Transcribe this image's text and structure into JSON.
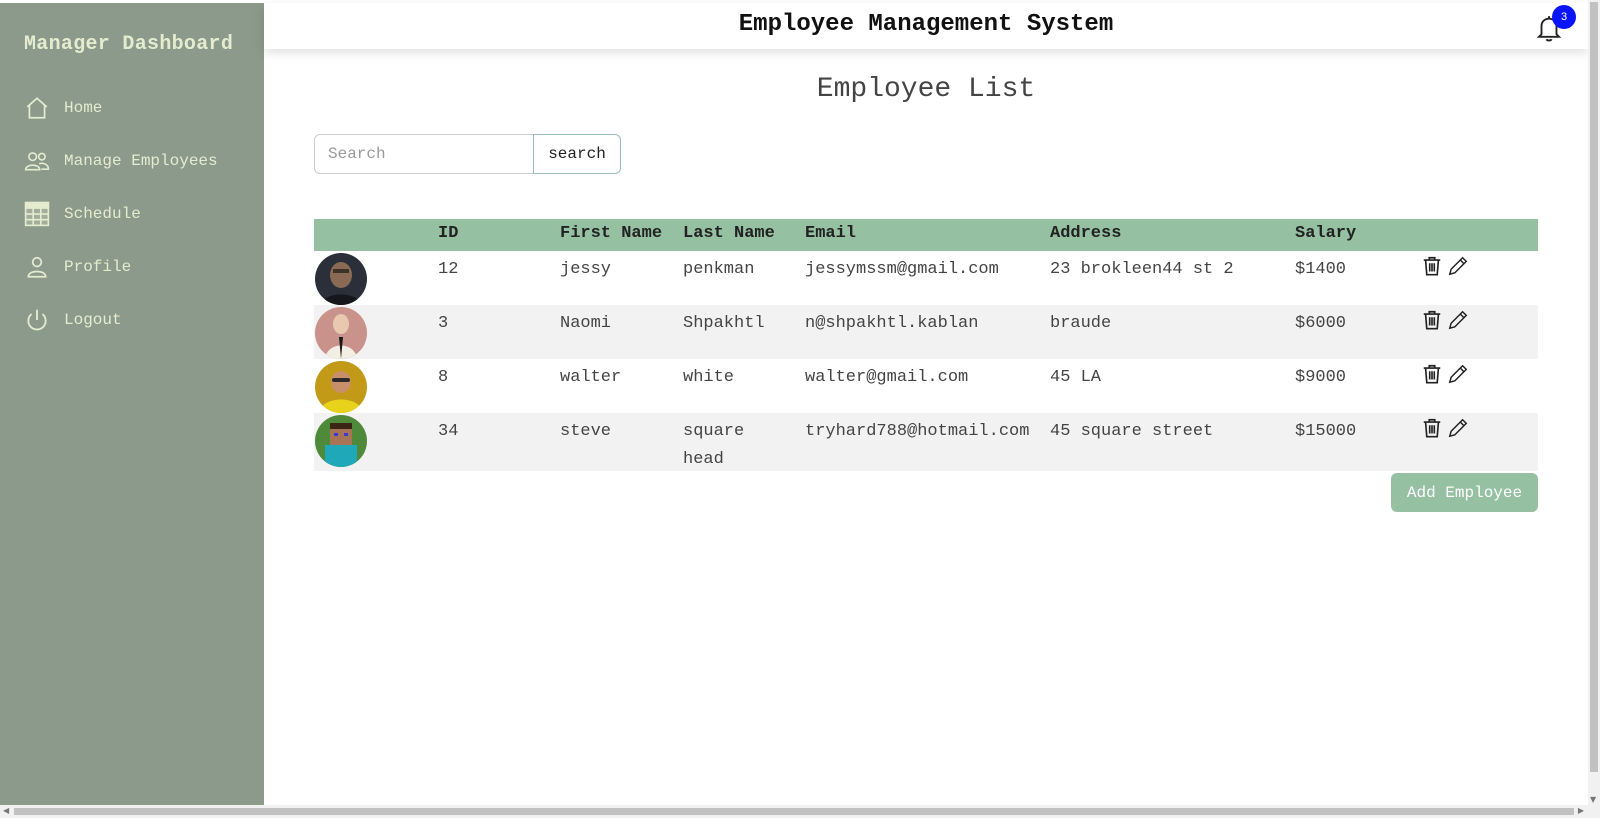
{
  "sidebar": {
    "title": "Manager Dashboard",
    "items": [
      {
        "label": "Home",
        "icon": "home-icon"
      },
      {
        "label": "Manage Employees",
        "icon": "users-icon"
      },
      {
        "label": "Schedule",
        "icon": "table-grid-icon"
      },
      {
        "label": "Profile",
        "icon": "person-icon"
      },
      {
        "label": "Logout",
        "icon": "power-icon"
      }
    ]
  },
  "header": {
    "title": "Employee Management System",
    "notification_count": "3"
  },
  "main": {
    "heading": "Employee List",
    "search": {
      "placeholder": "Search",
      "value": "",
      "button_label": "search"
    },
    "columns": [
      "ID",
      "First Name",
      "Last Name",
      "Email",
      "Address",
      "Salary"
    ],
    "rows": [
      {
        "id": "12",
        "first_name": "jessy",
        "last_name": "penkman",
        "email": "jessymssm@gmail.com",
        "address": "23 brokleen44 st 2",
        "salary": "$1400"
      },
      {
        "id": "3",
        "first_name": "Naomi",
        "last_name": "Shpakhtl",
        "email": "n@shpakhtl.kablan",
        "address": "braude",
        "salary": "$6000"
      },
      {
        "id": "8",
        "first_name": "walter",
        "last_name": "white",
        "email": "walter@gmail.com",
        "address": "45 LA",
        "salary": "$9000"
      },
      {
        "id": "34",
        "first_name": "steve",
        "last_name": "square head",
        "email": "tryhard788@hotmail.com",
        "address": "45 square street",
        "salary": "$15000"
      }
    ],
    "add_button_label": "Add Employee"
  },
  "colors": {
    "sidebar_bg": "#8b9a8b",
    "sidebar_text": "#e4ecd0",
    "table_header_bg": "#95c0a2",
    "row_alt_bg": "#f2f2f2",
    "badge_bg": "#0a14ff"
  }
}
